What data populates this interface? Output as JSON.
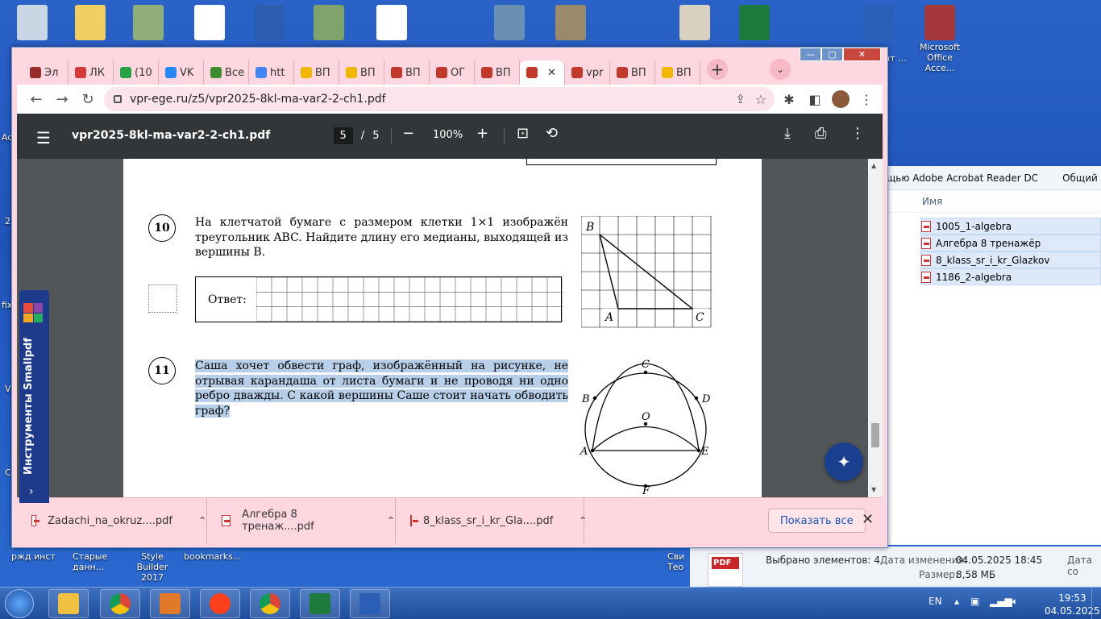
{
  "desktop": {
    "icons": [
      {
        "label": "",
        "color": "#c8d6e6"
      },
      {
        "label": "",
        "color": "#f0d060"
      },
      {
        "label": "",
        "color": "#8fae7a"
      },
      {
        "label": "",
        "color": "#ffffff"
      },
      {
        "label": "",
        "color": "#2a5db0"
      },
      {
        "label": "",
        "color": "#7fa36a"
      },
      {
        "label": "",
        "color": "#ffffff"
      },
      {
        "label": "",
        "color": "#6a8fb0"
      },
      {
        "label": "",
        "color": "#9a8a6a"
      },
      {
        "label": "",
        "color": "#d9d0c0"
      },
      {
        "label": "",
        "color": "#1e7a3c"
      },
      {
        "label": "",
        "color": "#2b5fb5"
      },
      {
        "label": "Microsoft Office Acce...",
        "color": "#a4373a"
      }
    ],
    "bottom_labels": [
      "ржд инст",
      "Старые данн...",
      "Style Builder 2017",
      "bookmarks..."
    ],
    "right_cut_label": "Сви Тео",
    "right_cut_top": "нт ...",
    "left_letters": [
      "Ad",
      "2",
      "fix",
      "V",
      "C"
    ]
  },
  "explorer": {
    "toolbar": [
      "щью Adobe Acrobat Reader DC",
      "Общий дост"
    ],
    "column": "Имя",
    "files": [
      "1005_1-algebra",
      "Алгебра 8 тренажёр",
      "8_klass_sr_i_kr_Glazkov",
      "1186_2-algebra"
    ],
    "status_selected": "Выбрано элементов: 4",
    "status_date_label": "Дата изменения:",
    "status_date": "04.05.2025 18:45",
    "status_date2": "Дата со",
    "status_size_label": "Размер:",
    "status_size": "8,58 МБ"
  },
  "browser": {
    "tabs": [
      {
        "label": "Эл",
        "color": "#9b2c2c"
      },
      {
        "label": "ЛК",
        "color": "#d33b3b"
      },
      {
        "label": "(10",
        "color": "#25a244"
      },
      {
        "label": "VK",
        "color": "#2787f5"
      },
      {
        "label": "Все",
        "color": "#3b8b2e"
      },
      {
        "label": "htt",
        "color": "#4285f4"
      },
      {
        "label": "ВП",
        "color": "#f2b705"
      },
      {
        "label": "ВП",
        "color": "#f2b705"
      },
      {
        "label": "ВП",
        "color": "#c0392b"
      },
      {
        "label": "ОГ",
        "color": "#c0392b"
      },
      {
        "label": "ВП",
        "color": "#c0392b"
      },
      {
        "label": "",
        "color": "#c0392b",
        "active": true
      },
      {
        "label": "vpr",
        "color": "#c0392b"
      },
      {
        "label": "ВП",
        "color": "#c0392b"
      },
      {
        "label": "ВП",
        "color": "#f2b705"
      }
    ],
    "url": "vpr-ege.ru/z5/vpr2025-8kl-ma-var2-2-ch1.pdf"
  },
  "pdf": {
    "title": "vpr2025-8kl-ma-var2-2-ch1.pdf",
    "page_current": "5",
    "page_sep": "/",
    "page_total": "5",
    "zoom": "100%",
    "q10": {
      "number": "10",
      "text": "На клетчатой бумаге с размером клетки 1×1 изображён треугольник ABC. Найдите длину его медианы, выходящей из вершины B.",
      "answer_label": "Ответ:",
      "labels": {
        "B": "B",
        "A": "A",
        "C": "C"
      }
    },
    "q11": {
      "number": "11",
      "text": "Саша хочет обвести граф, изображённый на рисунке, не отрывая карандаша от листа бумаги и не проводя ни одно ребро дважды. С какой вершины Саше стоит начать обводить граф?",
      "labels": {
        "C": "C",
        "B": "B",
        "D": "D",
        "O": "O",
        "A": "A",
        "E": "E",
        "F": "F"
      }
    }
  },
  "downloads": {
    "items": [
      "Zadachi_na_okruz....pdf",
      "Алгебра 8 тренаж....pdf",
      "8_klass_sr_i_kr_Gla....pdf"
    ],
    "show_all": "Показать все"
  },
  "smallpdf": {
    "label": "Инструменты Smallpdf"
  },
  "taskbar": {
    "lang": "EN",
    "time": "19:53",
    "date": "04.05.2025"
  }
}
